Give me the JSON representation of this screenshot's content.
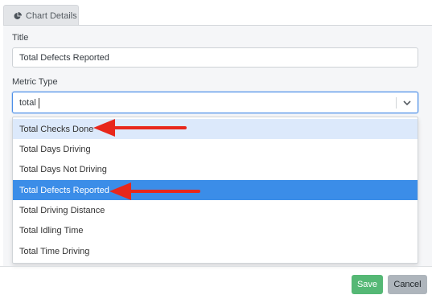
{
  "tab": {
    "label": "Chart Details",
    "icon": "pie-chart-icon"
  },
  "form": {
    "title_label": "Title",
    "title_value": "Total Defects Reported",
    "metric_label": "Metric Type",
    "metric_search": "total",
    "dropdown_icon": "chevron-down-icon"
  },
  "dropdown": {
    "options": [
      "Total Checks Done",
      "Total Days Driving",
      "Total Days Not Driving",
      "Total Defects Reported",
      "Total Driving Distance",
      "Total Idling Time",
      "Total Time Driving"
    ],
    "hovered": "Total Checks Done",
    "selected": "Total Defects Reported"
  },
  "footer": {
    "save_label": "Save",
    "cancel_label": "Cancel"
  },
  "colors": {
    "accent": "#3b8de8",
    "hover": "#dce9fb",
    "save": "#55b875",
    "cancel": "#aeb5bc",
    "annotation_arrow": "#e8271b"
  }
}
